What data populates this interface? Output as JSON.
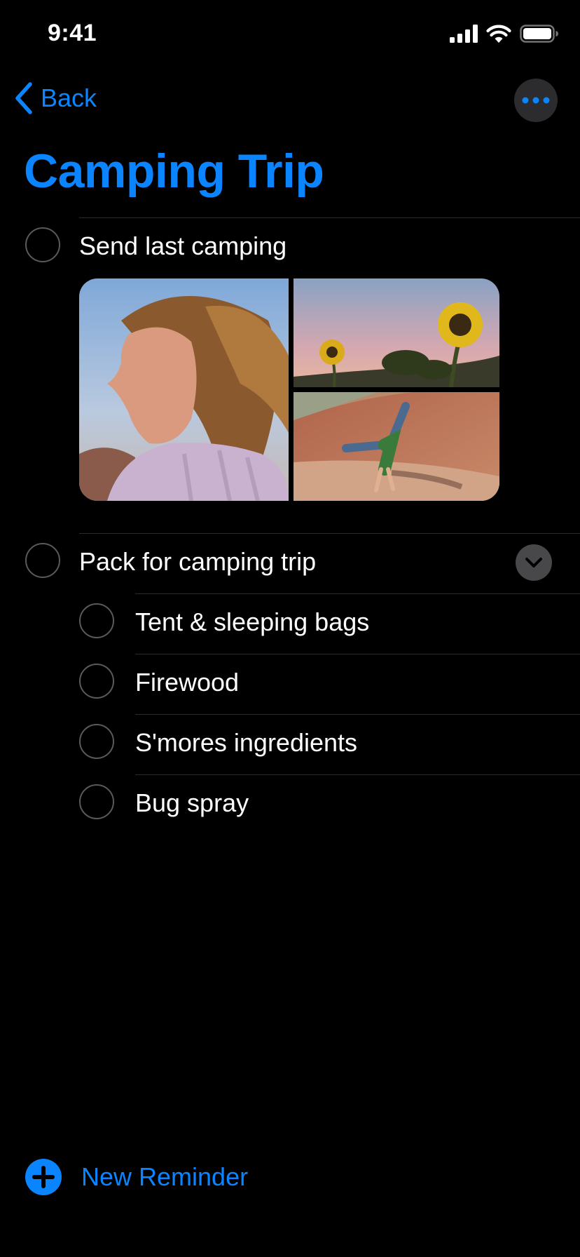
{
  "status_bar": {
    "time": "9:41",
    "icons": [
      "cellular-signal-icon",
      "wifi-icon",
      "battery-icon"
    ]
  },
  "nav": {
    "back_label": "Back",
    "back_icon": "chevron-left-icon",
    "more_icon": "ellipsis-icon"
  },
  "list": {
    "title": "Camping Trip",
    "accent_color": "#0a84ff",
    "reminders": [
      {
        "label": "Send last camping",
        "photos": [
          "portrait-photo",
          "sunflowers-photo",
          "cartwheel-photo"
        ]
      },
      {
        "label": "Pack for camping trip",
        "expand_icon": "chevron-down-icon",
        "subtasks": [
          {
            "label": "Tent & sleeping bags"
          },
          {
            "label": "Firewood"
          },
          {
            "label": "S'mores ingredients"
          },
          {
            "label": "Bug spray"
          }
        ]
      }
    ]
  },
  "footer": {
    "new_reminder_label": "New Reminder",
    "new_reminder_icon": "plus-circle-icon"
  }
}
